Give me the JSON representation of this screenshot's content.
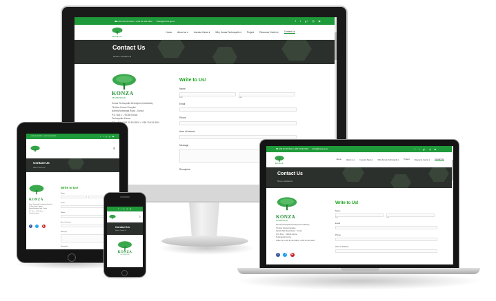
{
  "site": {
    "topbar": {
      "phone": "+254 20 434 9911 / +254 20 434 9914",
      "email": "info@konza.go.ke",
      "social_icons": [
        "facebook-icon",
        "twitter-icon",
        "google-plus-icon",
        "instagram-icon",
        "youtube-icon"
      ]
    },
    "logo": {
      "name": "KONZA",
      "tagline": "TECHNOPOLIS"
    },
    "menu": [
      "Home",
      "About us ▾",
      "Investor News ▾",
      "Why Konza Technopolis ▾",
      "Project",
      "Resource Center ▾",
      "Contact Us"
    ],
    "banner": {
      "title": "Contact Us",
      "breadcrumb": "Home » Contact Us"
    },
    "address": [
      "Konza Technopolis Development Authority",
      "7th floor Konza Complex",
      "Nairobi-Mombasa Road – Konza",
      "P.O. Box 1 – 90150 Konza",
      "Technopolis Konza",
      "Office Tel: +254 20 434 9911 / +254 20 434 9914"
    ],
    "form": {
      "heading": "Write to Us!",
      "name_label": "Name",
      "first_label": "First",
      "last_label": "Last",
      "email_label": "Email",
      "phone_label": "Phone",
      "interest_label": "Area of Interest",
      "message_label": "Message",
      "recaptcha_label": "Recaptcha"
    }
  },
  "colors": {
    "brand_green": "#1f9a3a",
    "heading_green": "#1aa31a",
    "banner_dark": "#2c302c",
    "device_black": "#111111"
  }
}
